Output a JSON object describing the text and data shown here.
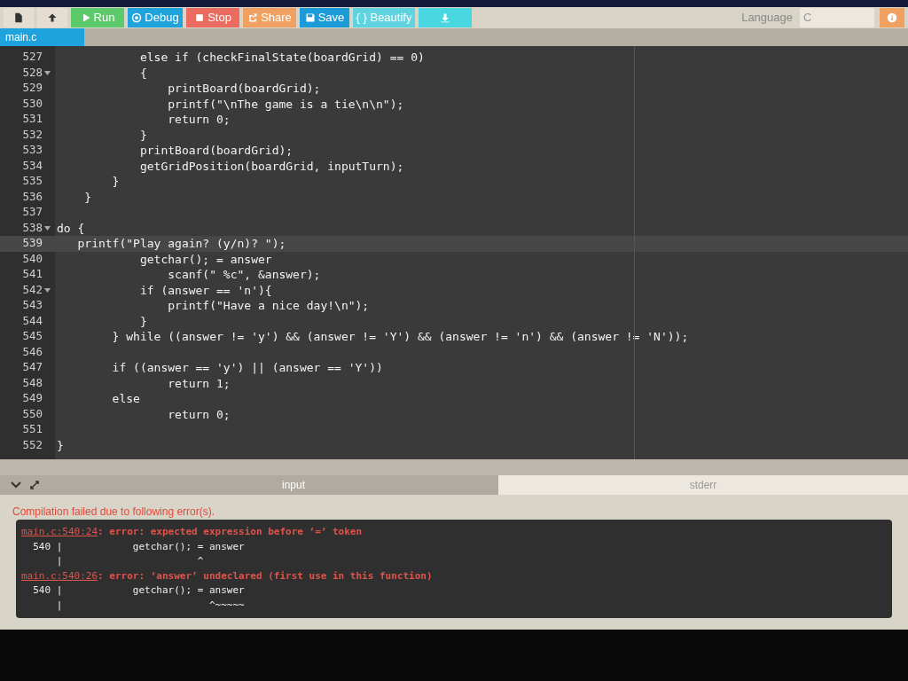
{
  "toolbar": {
    "buttons": [
      {
        "kind": "new-file"
      },
      {
        "kind": "upload"
      },
      {
        "kind": "run",
        "label": "Run"
      },
      {
        "kind": "debug",
        "label": "Debug"
      },
      {
        "kind": "stop",
        "label": "Stop"
      },
      {
        "kind": "share",
        "label": "Share"
      },
      {
        "kind": "save",
        "label": "Save"
      },
      {
        "kind": "beautify",
        "label": "{ } Beautify"
      },
      {
        "kind": "download"
      }
    ],
    "language_label": "Language",
    "language_value": "C"
  },
  "file_tabs": [
    {
      "label": "main.c",
      "selected": true
    }
  ],
  "editor": {
    "lines": [
      {
        "number": "527",
        "text": "            else if (checkFinalState(boardGrid) == 0)",
        "fold": false,
        "current": false
      },
      {
        "number": "528",
        "text": "            {",
        "fold": true,
        "current": false
      },
      {
        "number": "529",
        "text": "                printBoard(boardGrid);",
        "fold": false,
        "current": false
      },
      {
        "number": "530",
        "text": "                printf(\"\\nThe game is a tie\\n\\n\");",
        "fold": false,
        "current": false
      },
      {
        "number": "531",
        "text": "                return 0;",
        "fold": false,
        "current": false
      },
      {
        "number": "532",
        "text": "            }",
        "fold": false,
        "current": false
      },
      {
        "number": "533",
        "text": "            printBoard(boardGrid);",
        "fold": false,
        "current": false
      },
      {
        "number": "534",
        "text": "            getGridPosition(boardGrid, inputTurn);",
        "fold": false,
        "current": false
      },
      {
        "number": "535",
        "text": "        }",
        "fold": false,
        "current": false
      },
      {
        "number": "536",
        "text": "    }",
        "fold": false,
        "current": false
      },
      {
        "number": "537",
        "fold": false,
        "current": false
      },
      {
        "number": "538",
        "text": "do {",
        "fold": true,
        "current": false
      },
      {
        "number": "539",
        "text": "   printf(\"Play again? (y/n)? \");",
        "fold": false,
        "current": true
      },
      {
        "number": "540",
        "text": "            getchar(); = answer",
        "fold": false,
        "current": false
      },
      {
        "number": "541",
        "text": "                scanf(\" %c\", &answer);",
        "fold": false,
        "current": false
      },
      {
        "number": "542",
        "text": "            if (answer == 'n'){",
        "fold": true,
        "current": false
      },
      {
        "number": "543",
        "text": "                printf(\"Have a nice day!\\n\");",
        "fold": false,
        "current": false
      },
      {
        "number": "544",
        "text": "            }",
        "fold": false,
        "current": false
      },
      {
        "number": "545",
        "text": "        } while ((answer != 'y') && (answer != 'Y') && (answer != 'n') && (answer != 'N'));",
        "fold": false,
        "current": false
      },
      {
        "number": "546",
        "fold": false,
        "current": false
      },
      {
        "number": "547",
        "text": "        if ((answer == 'y') || (answer == 'Y'))",
        "fold": false,
        "current": false
      },
      {
        "number": "548",
        "text": "                return 1;",
        "fold": false,
        "current": false
      },
      {
        "number": "549",
        "text": "        else",
        "fold": false,
        "current": false
      },
      {
        "number": "550",
        "text": "                return 0;",
        "fold": false,
        "current": false
      },
      {
        "number": "551",
        "fold": false,
        "current": false
      },
      {
        "number": "552",
        "text": "}",
        "fold": false,
        "current": false
      }
    ]
  },
  "output": {
    "tabs": [
      {
        "label": "input",
        "selected": true
      },
      {
        "label": "stderr",
        "selected": false
      }
    ],
    "message": "Compilation failed due to following error(s).",
    "errors": [
      {
        "location": "main.c:540:24",
        "message": ": error: expected expression before ‘=’ token",
        "lines": [
          "  540 |            getchar(); = answer",
          "      |                       ^"
        ]
      },
      {
        "location": "main.c:540:26",
        "message": ": error: ‘answer’ undeclared (first use in this function)",
        "lines": [
          "  540 |            getchar(); = answer",
          "      |                         ^~~~~~"
        ]
      }
    ]
  }
}
